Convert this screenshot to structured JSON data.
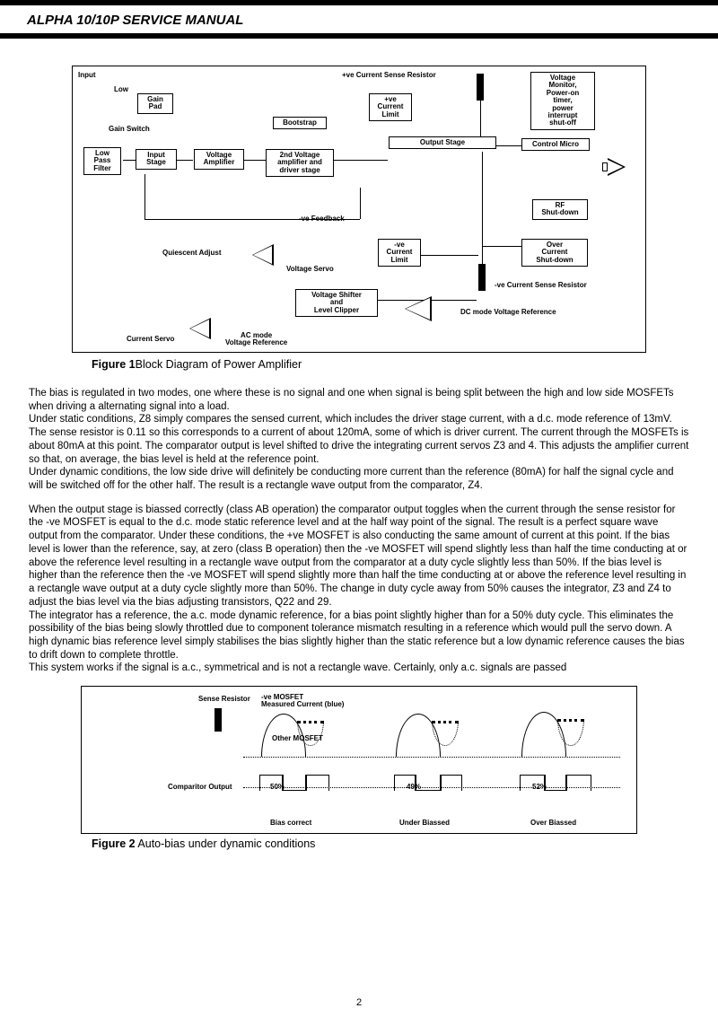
{
  "header": {
    "title": "ALPHA 10/10P SERVICE MANUAL"
  },
  "fig1": {
    "caption_bold": "Figure 1",
    "caption_rest": "Block Diagram of Power Amplifier",
    "labels": {
      "input": "Input",
      "low": "Low",
      "gain_pad": "Gain\nPad",
      "gain_switch": "Gain Switch",
      "lpf": "Low\nPass\nFilter",
      "input_stage": "Input\nStage",
      "voltage_amp": "Voltage\nAmplifier",
      "bootstrap": "Bootstrap",
      "second_va": "2nd Voltage\namplifier and\ndriver stage",
      "pos_csr": "+ve Current Sense Resistor",
      "pos_cl": "+ve\nCurrent\nLimit",
      "output_stage": "Output Stage",
      "vmon": "Voltage\nMonitor,\nPower-on\ntimer,\npower\ninterrupt\nshut-off",
      "control_micro": "Control Micro",
      "rf_sd": "RF\nShut-down",
      "neg_fb": "-ve Feedback",
      "quiescent": "Quiescent Adjust",
      "voltage_servo": "Voltage Servo",
      "neg_cl": "-ve\nCurrent\nLimit",
      "over_current": "Over\nCurrent\nShut-down",
      "voltage_shifter": "Voltage Shifter\nand\nLevel Clipper",
      "neg_csr": "-ve Current Sense Resistor",
      "dc_ref": "DC mode Voltage Reference",
      "current_servo": "Current Servo",
      "ac_ref": "AC mode\nVoltage Reference"
    }
  },
  "body": {
    "p1": "The bias is regulated in two modes, one where these is no signal and one when signal is being split between the high and low side MOSFETs when driving a alternating signal into a load.",
    "p2": "Under static conditions, Z8 simply compares the sensed current, which includes the driver stage current, with a d.c. mode reference of 13mV. The sense resistor is 0.11  so this corresponds to a current of about 120mA, some of which is driver current. The current through the MOSFETs is about 80mA at this point. The comparator output is level shifted to drive the integrating current servos Z3 and 4. This adjusts the amplifier current so that, on average, the bias level is held at the reference point.",
    "p3": "Under dynamic conditions, the low side drive will definitely be conducting more current than the reference (80mA) for half the signal cycle and will be switched off for the other half. The result is a rectangle wave output from the comparator, Z4.",
    "p4": "When the output stage is biassed correctly (class AB operation) the comparator output toggles when the current through the sense resistor for the -ve MOSFET is equal to the d.c. mode static reference level and at the half way point of the signal. The result is a perfect square wave output from the comparator. Under these conditions, the +ve MOSFET is also conducting the same amount of current at this point. If the bias level is lower than the reference, say, at zero (class B operation) then the -ve MOSFET will spend slightly less than half the time conducting at or above the reference level resulting in a rectangle wave output from the comparator at a duty cycle slightly less than 50%. If the bias level is higher than the reference then the -ve MOSFET will spend slightly more than half the time conducting at or above the reference level resulting in a rectangle wave output at a duty cycle slightly more than 50%. The change in duty cycle away from 50% causes the integrator, Z3 and Z4 to adjust the bias level via the bias adjusting transistors, Q22 and 29.",
    "p5": "The integrator has a reference, the a.c. mode dynamic reference,  for a bias point slightly higher than for a 50% duty cycle. This eliminates the possibility of the bias being slowly throttled due to component tolerance mismatch resulting in a reference which would pull the servo down. A high dynamic bias reference level simply stabilises the bias slightly higher than the static reference but a low dynamic reference causes the bias to drift down to complete throttle.",
    "p6": "This system works if the signal is a.c., symmetrical and is not a rectangle wave. Certainly, only a.c. signals are passed"
  },
  "fig2": {
    "caption_bold": "Figure 2",
    "caption_rest": " Auto-bias under dynamic conditions",
    "labels": {
      "sense_resistor": "Sense Resistor",
      "neg_mosfet": "-ve MOSFET\nMeasured Current (blue)",
      "other_mosfet": "Other MOSFET",
      "comparitor": "Comparitor Output",
      "p50": "50%",
      "p49": "49%",
      "p52": "52%",
      "bias_correct": "Bias correct",
      "under_biassed": "Under Biassed",
      "over_biassed": "Over Biassed"
    }
  },
  "page_number": "2"
}
